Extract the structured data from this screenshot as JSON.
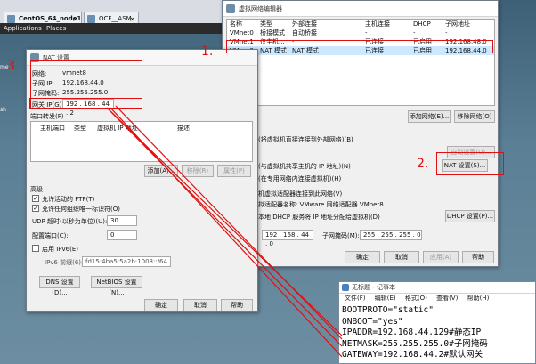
{
  "vmware": {
    "tabs": [
      "CentOS_64_node1",
      "OCF__ASM"
    ],
    "menu": [
      "Applications",
      "Places"
    ],
    "left_icon_labels": [
      "me",
      "sh"
    ]
  },
  "nat": {
    "title": "NAT 设置",
    "network_label": "网络:",
    "network_value": "vmnet8",
    "subnet_ip_label": "子网 IP:",
    "subnet_ip_value": "192.168.44.0",
    "mask_label": "子网掩码:",
    "mask_value": "255.255.255.0",
    "gateway_label": "网关 IP(G):",
    "gateway_value": "192 . 168 . 44 . 2",
    "pf_header": "端口转发(F)",
    "pf_columns": [
      "主机端口",
      "类型",
      "虚拟机 IP 地址",
      "描述"
    ],
    "add_btn": "添加(A)...",
    "remove_btn": "移除(R)",
    "props_btn": "属性(P)",
    "advanced": "高级",
    "allow_ftp": "允许活动的 FTP(T)",
    "allow_uuid": "允许任何组织唯一标识符(O)",
    "udp_label": "UDP 超时(以秒为单位)(U):",
    "udp_value": "30",
    "config_port_label": "配置端口(C):",
    "config_port_value": "0",
    "ipv6_enable": "启用 IPv6(E)",
    "ipv6_prefix_label": "IPv6 前缀(6):",
    "ipv6_prefix_value": "fd15:4ba5:5a2b:1008::/64",
    "dns_btn": "DNS 设置(D)...",
    "netbios_btn": "NetBIOS 设置(N)...",
    "ok": "确定",
    "cancel": "取消",
    "help": "帮助"
  },
  "vne": {
    "title": "虚拟网络编辑器",
    "columns": [
      "名称",
      "类型",
      "外部连接",
      "主机连接",
      "DHCP",
      "子网地址"
    ],
    "rows": [
      [
        "VMnet0",
        "桥接模式",
        "自动桥接",
        "-",
        "-",
        "-"
      ],
      [
        "VMnet1",
        "仅主机...",
        "-",
        "已连接",
        "已启用",
        "192.168.48.0"
      ],
      [
        "VMnet8",
        "NAT 模式",
        "NAT 模式",
        "已连接",
        "已启用",
        "192.168.44.0"
      ]
    ],
    "add_net": "添加网络(E)...",
    "remove_net": "移除网络(O)",
    "bridge_text": "(将虚拟机直接连接到外部网络)(B)",
    "auto_settings": "自动设置(U)...",
    "nat_text": "(与虚拟机共享主机的 IP 地址)(N)",
    "nat_settings": "NAT 设置(S)...",
    "hostonly_text": "(在专用网络内连接虚拟机)(H)",
    "adapter_text": "机虚拟适配器连接到此网络(V)",
    "adapter_name": "拟适配器名称: VMware 网络适配器 VMnet8",
    "dhcp_text": "本地 DHCP 服务将 IP 地址分配给虚拟机(D)",
    "dhcp_settings": "DHCP 设置(P)...",
    "subnet_value": "192 . 168 . 44 . 0",
    "mask_label": "子网掩码(M):",
    "mask_value": "255 . 255 . 255 . 0",
    "ok": "确定",
    "cancel": "取消",
    "apply": "应用(A)",
    "help": "帮助"
  },
  "notepad": {
    "title": "无标题 - 记事本",
    "menu": [
      "文件(F)",
      "编辑(E)",
      "格式(O)",
      "查看(V)",
      "帮助(H)"
    ],
    "lines": [
      "BOOTPROTO=\"static\"",
      "ONBOOT=\"yes\"",
      "IPADDR=192.168.44.129#静态IP",
      "NETMASK=255.255.255.0#子网掩码",
      "GATEWAY=192.168.44.2#默认网关"
    ]
  },
  "annotations": [
    "1.",
    "2.",
    "3"
  ],
  "colors": {
    "annotation": "#e01010",
    "selected_row": "#cce8ff"
  }
}
